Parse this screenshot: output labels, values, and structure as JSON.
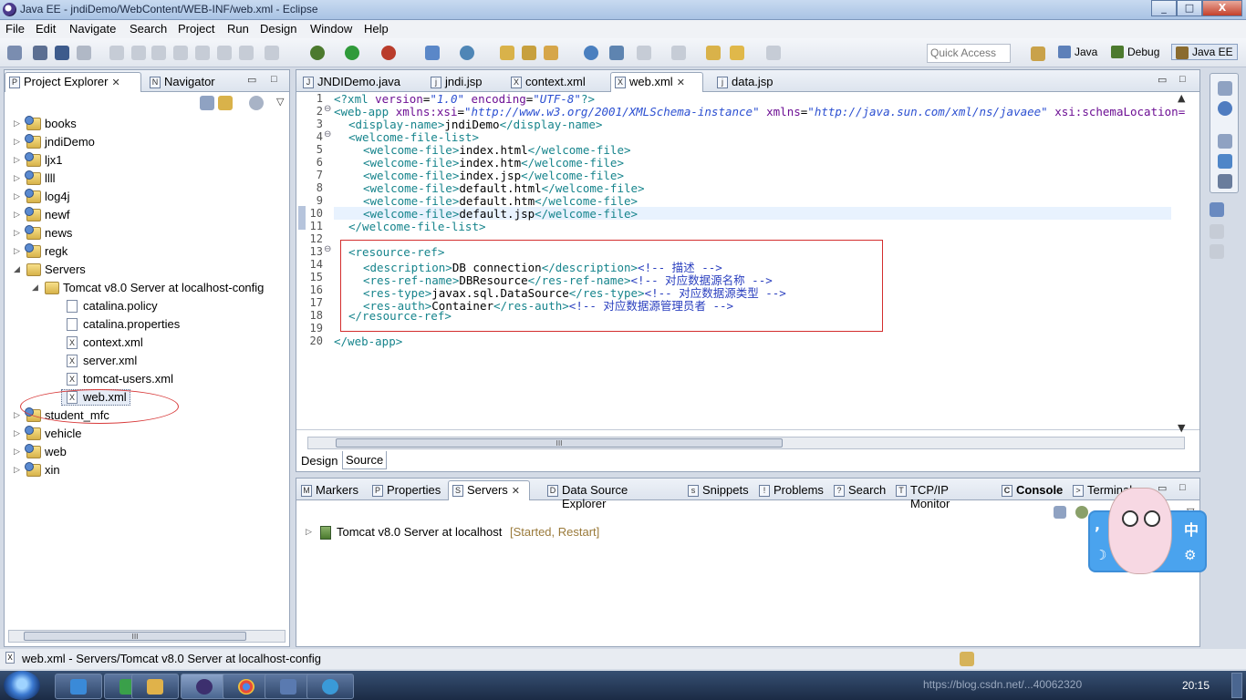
{
  "window": {
    "title": "Java EE - jndiDemo/WebContent/WEB-INF/web.xml - Eclipse",
    "min": "_",
    "max": "□",
    "close": "X"
  },
  "menu": [
    "File",
    "Edit",
    "Navigate",
    "Search",
    "Project",
    "Run",
    "Design",
    "Window",
    "Help"
  ],
  "quick_access": {
    "placeholder": "Quick Access"
  },
  "perspectives": [
    "Java",
    "Debug",
    "Java EE"
  ],
  "left_tabs": {
    "project_explorer": "Project Explorer",
    "navigator": "Navigator"
  },
  "tree": {
    "projects_top": [
      "books",
      "jndiDemo",
      "ljx1",
      "llll",
      "log4j",
      "newf",
      "news",
      "regk"
    ],
    "servers": "Servers",
    "tomcat_config": "Tomcat v8.0 Server at localhost-config",
    "config_files": [
      "catalina.policy",
      "catalina.properties",
      "context.xml",
      "server.xml",
      "tomcat-users.xml",
      "web.xml"
    ],
    "projects_bottom": [
      "student_mfc",
      "vehicle",
      "web",
      "xin"
    ]
  },
  "editor_tabs": [
    "JNDIDemo.java",
    "jndi.jsp",
    "context.xml",
    "web.xml",
    "data.jsp"
  ],
  "editor_bottom_tabs": [
    "Design",
    "Source"
  ],
  "code": {
    "line_numbers": [
      "1",
      "2",
      "3",
      "4",
      "5",
      "6",
      "7",
      "8",
      "9",
      "10",
      "11",
      "12",
      "13",
      "14",
      "15",
      "16",
      "17",
      "18",
      "19",
      "20"
    ],
    "l1": {
      "a": "<?xml ",
      "b": "version",
      "c": "=",
      "d": "\"1.0\"",
      "e": " encoding",
      "f": "=",
      "g": "\"UTF-8\"",
      "h": "?>"
    },
    "l2": {
      "a": "<web-app ",
      "b": "xmlns:xsi",
      "c": "=",
      "d": "\"http://www.w3.org/2001/XMLSchema-instance\"",
      "e": " xmlns",
      "f": "=",
      "g": "\"http://java.sun.com/xml/ns/javaee\"",
      "h": " xsi:schemaLocation="
    },
    "l3": {
      "open": "<display-name>",
      "text": "jndiDemo",
      "close": "</display-name>"
    },
    "l4": "<welcome-file-list>",
    "welcome_files": [
      "index.html",
      "index.htm",
      "index.jsp",
      "default.html",
      "default.htm",
      "default.jsp"
    ],
    "wf_open": "<welcome-file>",
    "wf_close": "</welcome-file>",
    "l11": "</welcome-file-list>",
    "l13": "<resource-ref>",
    "l14": {
      "open": "<description>",
      "text": "DB connection",
      "close": "</description>",
      "comment": "<!-- 描述 -->"
    },
    "l15": {
      "open": "<res-ref-name>",
      "text": "DBResource",
      "close": "</res-ref-name>",
      "comment": "<!-- 对应数据源名称 -->"
    },
    "l16": {
      "open": "<res-type>",
      "text": "javax.sql.DataSource",
      "close": "</res-type>",
      "comment": "<!-- 对应数据源类型 -->"
    },
    "l17": {
      "open": "<res-auth>",
      "text": "Container",
      "close": "</res-auth>",
      "comment": "<!-- 对应数据源管理员者 -->"
    },
    "l18": "</resource-ref>",
    "l20": "</web-app>"
  },
  "bottom_tabs": [
    "Markers",
    "Properties",
    "Servers",
    "Data Source Explorer",
    "Snippets",
    "Problems",
    "Search",
    "TCP/IP Monitor",
    "Console",
    "Terminal"
  ],
  "server_entry": {
    "name": "Tomcat v8.0 Server at localhost",
    "state": "[Started, Restart]"
  },
  "status_bar": {
    "text": "web.xml - Servers/Tomcat v8.0 Server at localhost-config"
  },
  "ime": {
    "zh": "中",
    "comma": ",",
    "moon": "☽",
    "gear": "⚙"
  },
  "taskbar": {
    "clock": "20:15",
    "watermark": "https://blog.csdn.net/...40062320"
  },
  "colors": {
    "tag": "#16848c",
    "attr": "#6d0f94",
    "string": "#2b4fd1",
    "comment": "#2a3fbf",
    "annotation": "#d32d2d"
  }
}
